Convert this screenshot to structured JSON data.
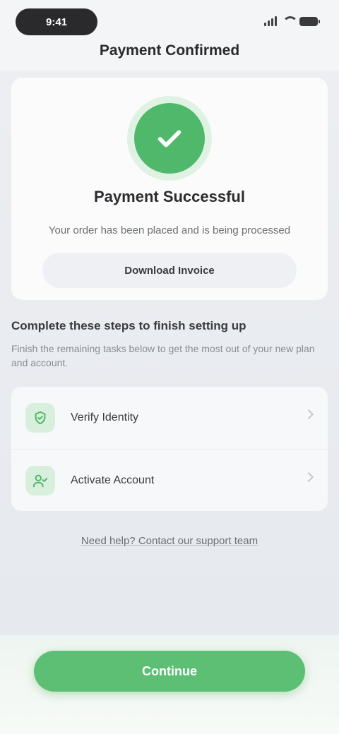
{
  "status_bar": {
    "time": "9:41"
  },
  "header": {
    "title": "Payment Confirmed"
  },
  "success": {
    "title": "Payment Successful",
    "subtitle": "Your order has been placed and is being processed",
    "invoice_button": "Download Invoice",
    "accent_color": "#4fb86a"
  },
  "next_steps": {
    "title": "Complete these steps to finish setting up",
    "description": "Finish the remaining tasks below to get the most out of your new plan and account.",
    "items": [
      {
        "label": "Verify Identity",
        "icon": "shield-check-icon"
      },
      {
        "label": "Activate Account",
        "icon": "user-check-icon"
      }
    ]
  },
  "help_link": "Need help? Contact our support team",
  "primary_button": {
    "label": "Continue",
    "color": "#5cbf74"
  }
}
